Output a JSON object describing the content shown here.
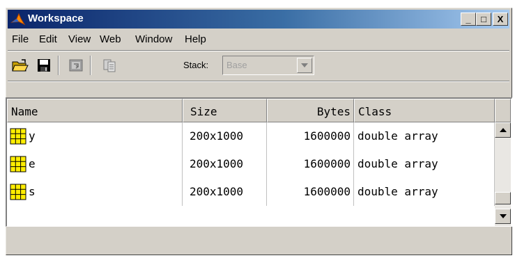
{
  "window": {
    "title": "Workspace",
    "minimize_label": "_",
    "maximize_label": "□",
    "close_label": "X"
  },
  "menu": [
    {
      "label": "File"
    },
    {
      "label": "Edit"
    },
    {
      "label": "View"
    },
    {
      "label": "Web"
    },
    {
      "label": "Window"
    },
    {
      "label": "Help"
    }
  ],
  "toolbar": {
    "icons": [
      "open-folder-icon",
      "save-icon",
      "import-data-icon",
      "delete-variable-icon"
    ],
    "stack_label": "Stack:",
    "stack_value": "Base"
  },
  "table": {
    "columns": [
      "Name",
      "Size",
      "Bytes",
      "Class"
    ],
    "rows": [
      {
        "name": "y",
        "size": "200x1000",
        "bytes": "1600000",
        "class": "double array"
      },
      {
        "name": "e",
        "size": "200x1000",
        "bytes": "1600000",
        "class": "double array"
      },
      {
        "name": "s",
        "size": "200x1000",
        "bytes": "1600000",
        "class": "double array"
      }
    ]
  },
  "colors": {
    "titlebar_start": "#0a246a",
    "titlebar_end": "#a6caf0",
    "window_face": "#d4d0c8",
    "array_icon": "#ffee00"
  }
}
